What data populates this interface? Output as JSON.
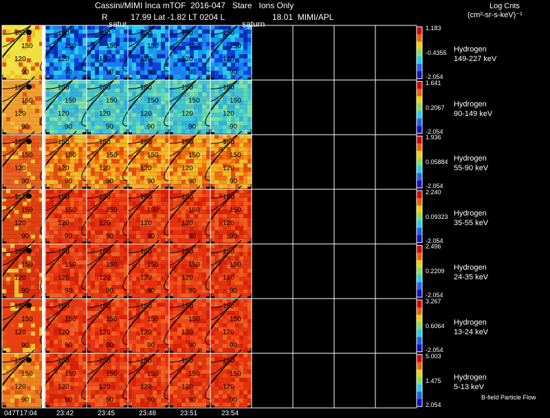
{
  "header": {
    "title_line": "Cassini/MIMI Inca mTOF  2016-047   Stare   Ions Only",
    "r_label": "R",
    "orbit_line": "17.99 Lat -1.82 LT 0204 L",
    "l_value": "18.01  MIMI/APL",
    "saturn_left": "satur",
    "saturn_right": "saturn",
    "units_title": "Log Cnts",
    "units_line": "(cm²-sr-s-keV)⁻¹"
  },
  "rows": [
    {
      "species": "Hydrogen",
      "energy": "149-227 keV",
      "cb_max": "1.183",
      "cb_mid": "-0.4355",
      "cb_min": "-2.054",
      "scheme": "blue"
    },
    {
      "species": "Hydrogen",
      "energy": "90-149 keV",
      "cb_max": "1.641",
      "cb_mid": "0.2067",
      "cb_min": "-2.054",
      "scheme": "cyan"
    },
    {
      "species": "Hydrogen",
      "energy": "55-90 keV",
      "cb_max": "1.936",
      "cb_mid": "0.05884",
      "cb_min": "-2.054",
      "scheme": "orange"
    },
    {
      "species": "Hydrogen",
      "energy": "35-55 keV",
      "cb_max": "2.240",
      "cb_mid": "0.09323",
      "cb_min": "-2.054",
      "scheme": "red"
    },
    {
      "species": "Hydrogen",
      "energy": "24-35 keV",
      "cb_max": "2.496",
      "cb_mid": "0.2209",
      "cb_min": "-2.054",
      "scheme": "red"
    },
    {
      "species": "Hydrogen",
      "energy": "13-24 keV",
      "cb_max": "3.267",
      "cb_mid": "0.6064",
      "cb_min": "-2.054",
      "scheme": "red"
    },
    {
      "species": "Hydrogen",
      "energy": "5-13 keV",
      "cb_max": "5.003",
      "cb_mid": "1.475",
      "cb_min": "2.054",
      "scheme": "red"
    }
  ],
  "contour_labels": [
    "180",
    "150",
    "120",
    "90",
    "60"
  ],
  "time_ticks": [
    "047T17:04",
    "23:42",
    "23:45",
    "23:48",
    "23:51",
    "23:54"
  ],
  "footer_note": "B-field Particle Flow",
  "colors": {
    "background": "#000000",
    "grid": "#ffffff",
    "contour": "#000000"
  }
}
